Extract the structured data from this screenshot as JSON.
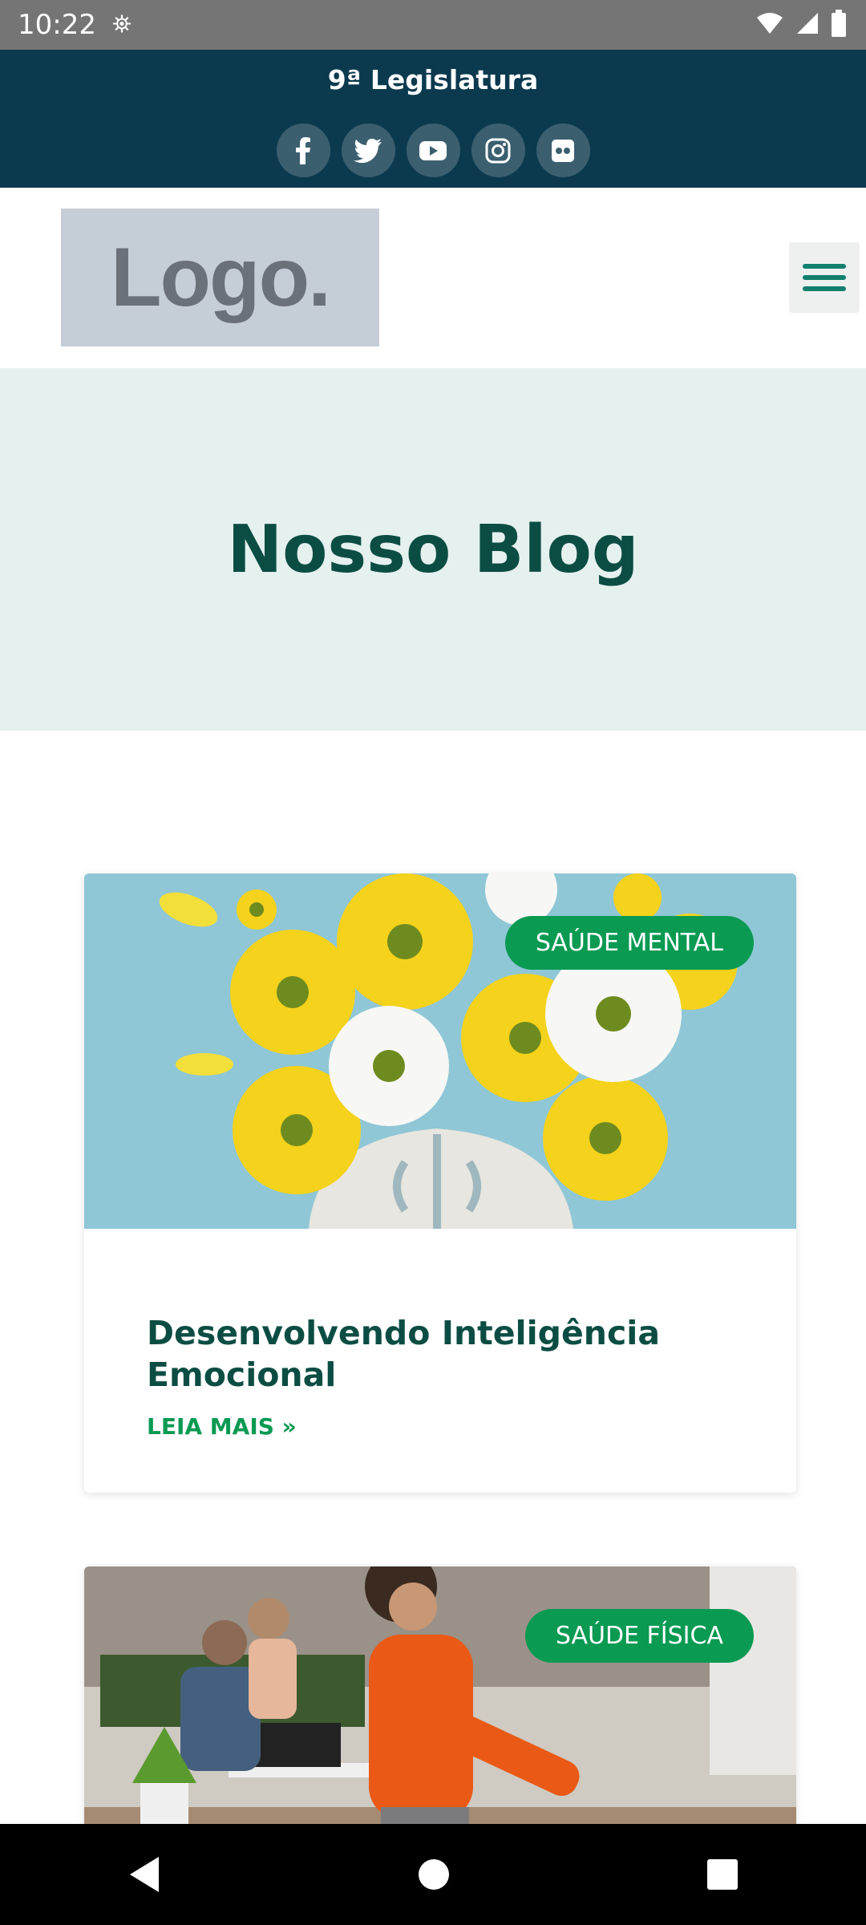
{
  "status_bar": {
    "time": "10:22"
  },
  "top_bar": {
    "legislatura": "9ª Legislatura",
    "social": [
      "facebook-icon",
      "twitter-icon",
      "youtube-icon",
      "instagram-icon",
      "flickr-icon"
    ]
  },
  "header": {
    "logo_text": "Logo."
  },
  "hero": {
    "title": "Nosso Blog"
  },
  "posts": [
    {
      "category": "SAÚDE MENTAL",
      "title": "Desenvolvendo Inteligência Emocional",
      "read_more": "LEIA MAIS »"
    },
    {
      "category": "SAÚDE FÍSICA"
    }
  ],
  "colors": {
    "top_bar_bg": "#0b3a4f",
    "accent_green": "#0a9a52",
    "title_green": "#0c4d43",
    "hero_bg": "#e5f1ef"
  }
}
